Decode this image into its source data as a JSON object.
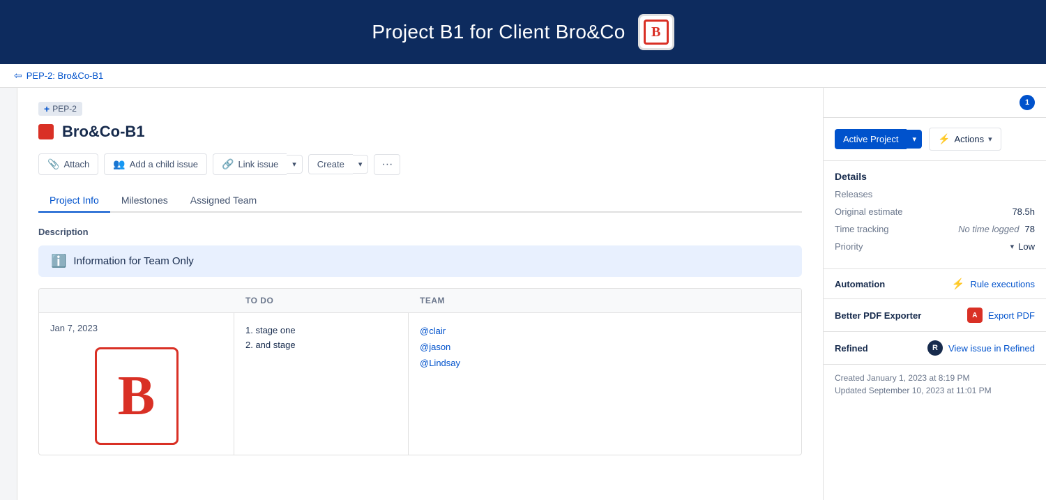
{
  "header": {
    "title": "Project B1 for Client Bro&Co"
  },
  "breadcrumb": {
    "link_text": "PEP-2: Bro&Co-B1",
    "icon": "⇦"
  },
  "issue": {
    "id": "PEP-2",
    "title": "Bro&Co-B1"
  },
  "toolbar": {
    "attach_label": "Attach",
    "add_child_label": "Add a child issue",
    "link_issue_label": "Link issue",
    "create_label": "Create",
    "more_label": "···"
  },
  "tabs": [
    {
      "label": "Project Info",
      "active": true
    },
    {
      "label": "Milestones",
      "active": false
    },
    {
      "label": "Assigned Team",
      "active": false
    }
  ],
  "description": {
    "label": "Description"
  },
  "info_banner": {
    "text": "Information for Team Only"
  },
  "table": {
    "columns": [
      "Jan 7, 2023",
      "TO DO",
      "Team"
    ],
    "todo_items": [
      "1.  stage one",
      "2. and stage"
    ],
    "team_items": [
      "@clair",
      "@jason",
      "@Lindsay"
    ]
  },
  "sidebar": {
    "notification_count": "1",
    "active_project_label": "Active Project",
    "actions_label": "Actions",
    "details_title": "Details",
    "releases_label": "Releases",
    "original_estimate_label": "Original estimate",
    "original_estimate_value": "78.5h",
    "time_tracking_label": "Time tracking",
    "time_no_logged": "No time logged",
    "time_right": "78",
    "priority_label": "Priority",
    "priority_value": "Low",
    "automation_label": "Automation",
    "automation_link": "Rule executions",
    "pdf_exporter_label": "Better PDF Exporter",
    "pdf_link": "Export PDF",
    "refined_label": "Refined",
    "refined_link": "View issue in Refined",
    "created_date": "Created January 1, 2023 at 8:19 PM",
    "updated_date": "Updated September 10, 2023 at 11:01 PM"
  }
}
